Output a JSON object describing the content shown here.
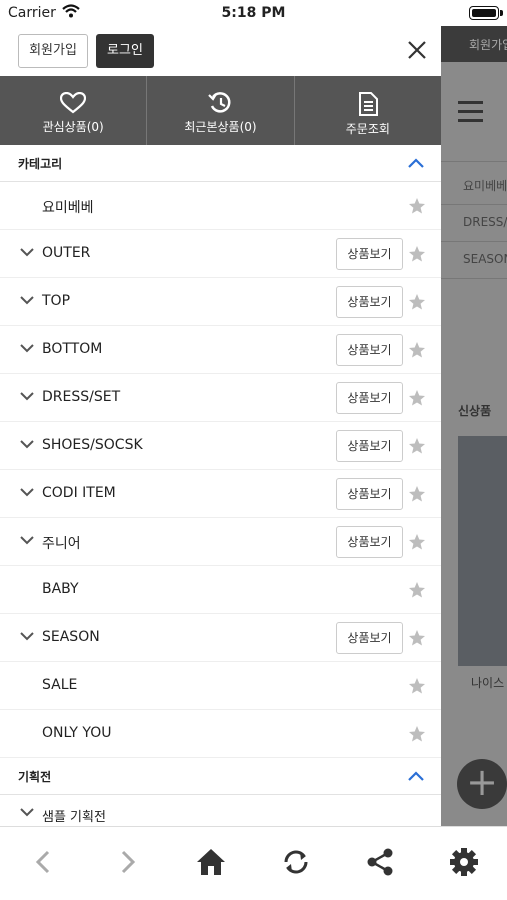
{
  "status_bar": {
    "carrier": "Carrier",
    "time": "5:18 PM"
  },
  "background_page": {
    "top_text": "회원가입",
    "nav_rows": [
      "요미베베",
      "DRESS/SET",
      "SEASON"
    ],
    "new_label": "신상품",
    "product_name": "나이스"
  },
  "drawer": {
    "join_label": "회원가입",
    "login_label": "로그인",
    "quick_menu": {
      "wishlist": "관심상품(0)",
      "recent": "최근본상품(0)",
      "orders": "주문조회"
    },
    "category_title": "카테고리",
    "view_button_label": "상품보기",
    "categories": [
      {
        "label": "요미베베",
        "expandable": false,
        "view_button": false
      },
      {
        "label": "OUTER",
        "expandable": true,
        "view_button": true
      },
      {
        "label": "TOP",
        "expandable": true,
        "view_button": true
      },
      {
        "label": "BOTTOM",
        "expandable": true,
        "view_button": true
      },
      {
        "label": "DRESS/SET",
        "expandable": true,
        "view_button": true
      },
      {
        "label": "SHOES/SOCSK",
        "expandable": true,
        "view_button": true
      },
      {
        "label": "CODI ITEM",
        "expandable": true,
        "view_button": true
      },
      {
        "label": "주니어",
        "expandable": true,
        "view_button": true
      },
      {
        "label": "BABY",
        "expandable": false,
        "view_button": false
      },
      {
        "label": "SEASON",
        "expandable": true,
        "view_button": true
      },
      {
        "label": "SALE",
        "expandable": false,
        "view_button": false
      },
      {
        "label": "ONLY YOU",
        "expandable": false,
        "view_button": false
      }
    ],
    "planning_title": "기획전",
    "planning_items": [
      "샘플 기획전"
    ]
  },
  "toolbar": {
    "icons": [
      "back-icon",
      "forward-icon",
      "home-icon",
      "refresh-icon",
      "share-icon",
      "settings-icon"
    ]
  },
  "colors": {
    "accent_blue": "#2a6fd6",
    "quick_bg": "#555555",
    "login_bg": "#333333",
    "star_gray": "#bdbdbd"
  }
}
